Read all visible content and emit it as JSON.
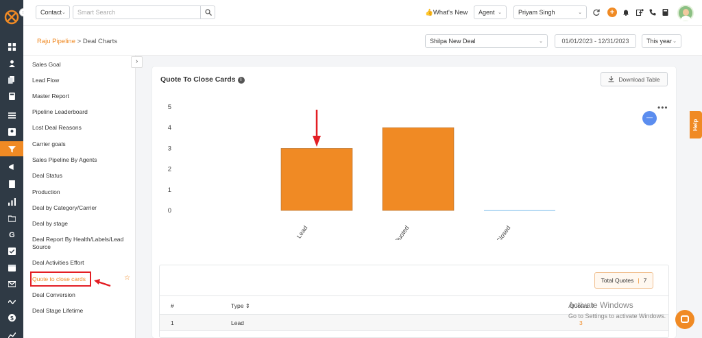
{
  "colors": {
    "accent": "#f08a24",
    "rail": "#2f3a45",
    "bar": "#f08a24",
    "highlight": "#e31e24",
    "bubble": "#5b8def"
  },
  "topbar": {
    "module_select": "Contact",
    "search_placeholder": "Smart Search",
    "whats_new": "👍What's New",
    "role_select": "Agent",
    "user_select": "Priyam Singh"
  },
  "breadcrumb": {
    "pipeline": "Raju Pipeline",
    "separator": " > ",
    "page": "Deal Charts"
  },
  "filters": {
    "deal_select": "Shilpa New Deal",
    "date_range": "01/01/2023 - 12/31/2023",
    "period_select": "This year"
  },
  "sidebar": {
    "items": [
      "Sales Goal",
      "Lead Flow",
      "Master Report",
      "Pipeline Leaderboard",
      "Lost Deal Reasons",
      "Carrier goals",
      "Sales Pipeline By Agents",
      "Deal Status",
      "Production",
      "Deal by Category/Carrier",
      "Deal by stage",
      "Deal Report By Health/Labels/Lead Source",
      "Deal Activities Effort",
      "Quote to close cards",
      "Deal Conversion",
      "Deal Stage Lifetime"
    ],
    "active_index": 13
  },
  "card": {
    "title": "Quote To Close Cards",
    "download_label": "Download Table",
    "help_label": "Help"
  },
  "chart_data": {
    "type": "bar",
    "categories": [
      "Lead",
      "Quoted",
      "Closed"
    ],
    "values": [
      3,
      4,
      0
    ],
    "ylim": [
      0,
      5
    ],
    "yticks": [
      "0",
      "1",
      "2",
      "3",
      "4",
      "5"
    ],
    "grid": false,
    "legend": "none"
  },
  "table": {
    "total_label": "Total Quotes",
    "total_value": "7",
    "columns": [
      "#",
      "Type ⇕",
      "Quotes ⇕"
    ],
    "rows": [
      {
        "index": "1",
        "type": "Lead",
        "quotes": "3"
      }
    ]
  },
  "watermark": {
    "line1": "Activate Windows",
    "line2": "Go to Settings to activate Windows."
  }
}
